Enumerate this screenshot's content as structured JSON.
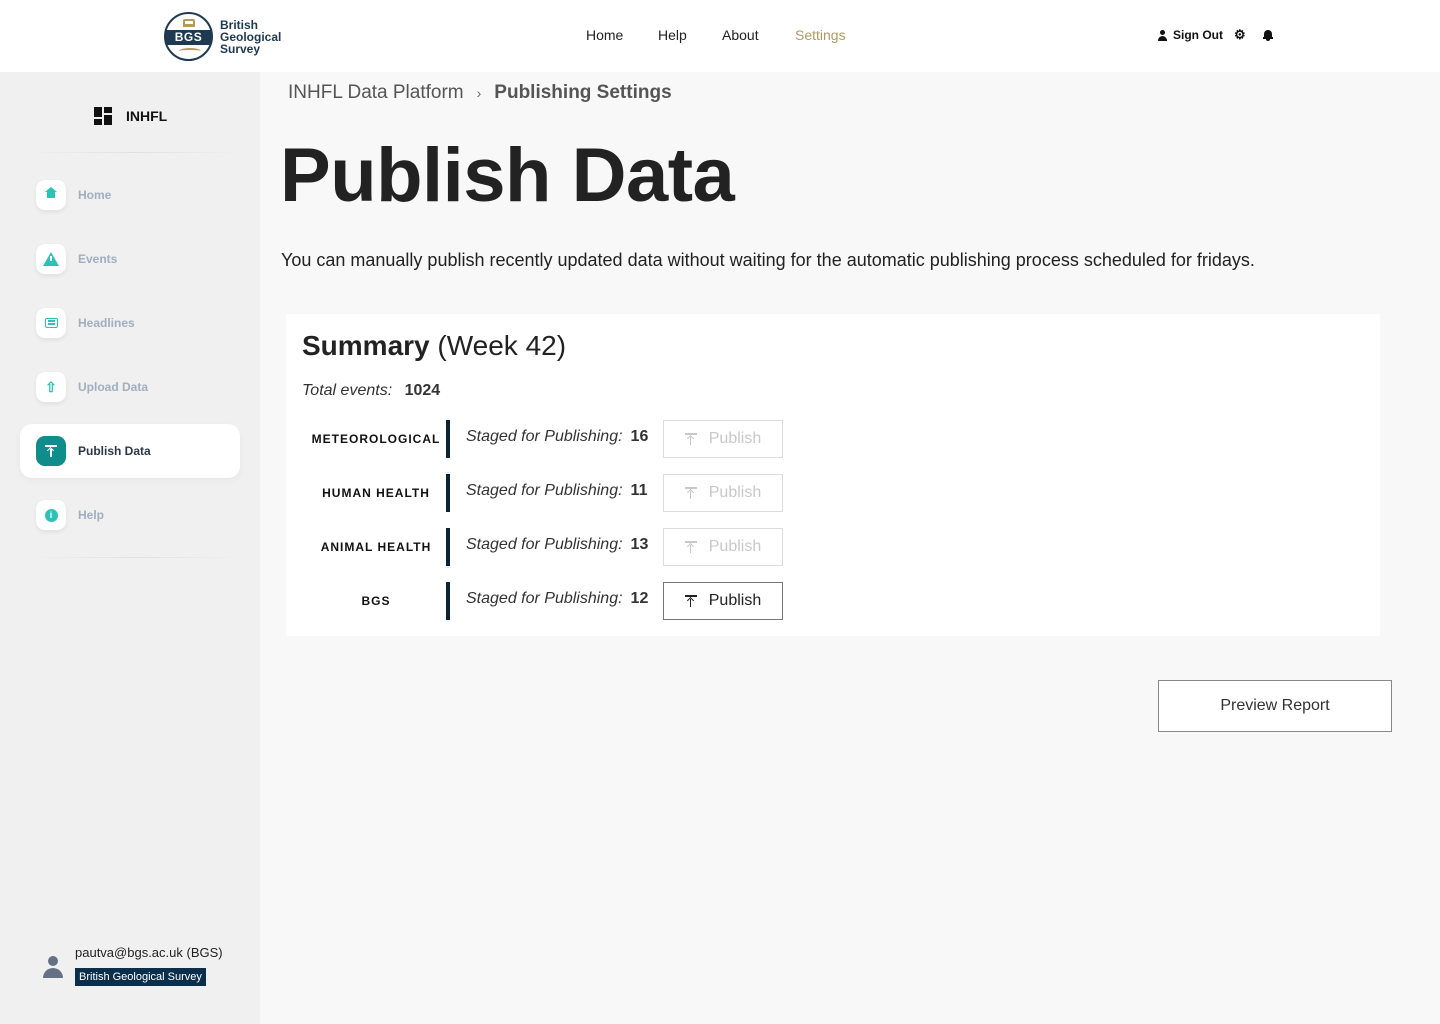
{
  "header": {
    "logo": {
      "badge_text": "BGS",
      "line1": "British",
      "line2": "Geological",
      "line3": "Survey"
    },
    "nav": {
      "home": "Home",
      "help": "Help",
      "about": "About",
      "settings": "Settings"
    },
    "active_nav_color": "#b09a5f",
    "sign_out": "Sign Out",
    "icons": [
      "user-icon",
      "gear-icon",
      "bell-icon"
    ]
  },
  "sidebar": {
    "brand": "INHFL",
    "items": [
      {
        "label": "Home",
        "icon": "home-icon"
      },
      {
        "label": "Events",
        "icon": "warning-icon"
      },
      {
        "label": "Headlines",
        "icon": "newspaper-icon"
      },
      {
        "label": "Upload Data",
        "icon": "upload-icon"
      },
      {
        "label": "Publish Data",
        "icon": "publish-icon",
        "active": true
      },
      {
        "label": "Help",
        "icon": "info-icon"
      }
    ],
    "account": {
      "email": "pautva@bgs.ac.uk (BGS)",
      "org": "British Geological Survey"
    }
  },
  "main": {
    "breadcrumb": {
      "root": "INHFL Data Platform",
      "separator": "›",
      "current": "Publishing Settings"
    },
    "title": "Publish Data",
    "intro": "You can manually publish recently updated data without waiting for the automatic publishing process scheduled for fridays.",
    "summary": {
      "heading": "Summary",
      "week": "(Week 42)",
      "total_label": "Total events:",
      "total_value": "1024",
      "staged_label": "Staged for Publishing:",
      "rows": [
        {
          "category": "METEOROLOGICAL",
          "staged": "16",
          "publish_label": "Publish",
          "enabled": false
        },
        {
          "category": "HUMAN HEALTH",
          "staged": "11",
          "publish_label": "Publish",
          "enabled": false
        },
        {
          "category": "ANIMAL HEALTH",
          "staged": "13",
          "publish_label": "Publish",
          "enabled": false
        },
        {
          "category": "BGS",
          "staged": "12",
          "publish_label": "Publish",
          "enabled": true
        }
      ]
    },
    "preview_button": "Preview Report"
  },
  "colors": {
    "accent": "#0f8c8c",
    "icon_teal": "#2cc2b8",
    "navy": "#0b2e4a"
  }
}
